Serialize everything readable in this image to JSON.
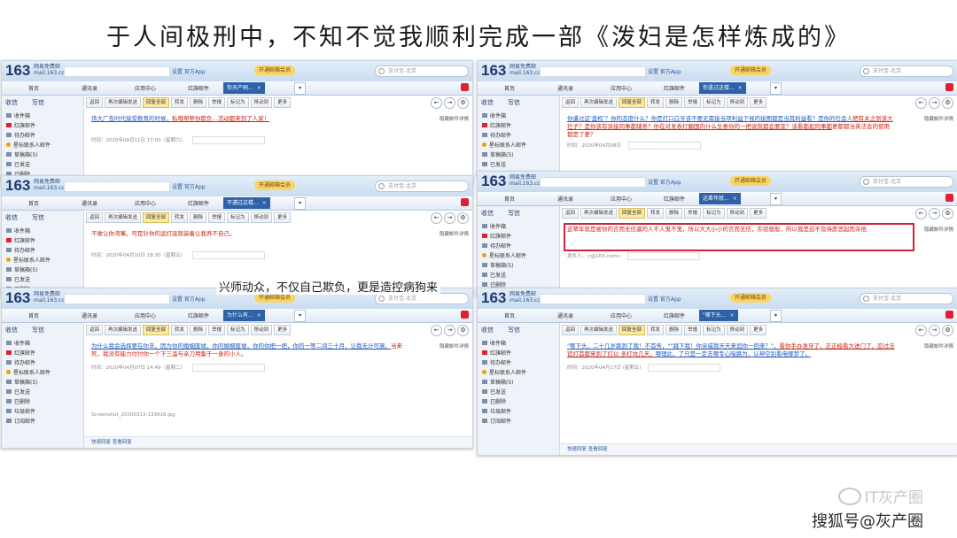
{
  "page_title": "于人间极刑中，不知不觉我顺利完成一部《泼妇是怎样炼成的》",
  "overlay_caption": "兴师动众，不仅自己欺负，更是造控病狗来",
  "watermarks": {
    "line1": "IT灰产圈",
    "line2": "搜狐号@灰产圈"
  },
  "mail": {
    "logo": "163",
    "logo_sub": "网易免费邮",
    "logo_url": "mail.163.com",
    "top_links": "设置  官方App",
    "vip_badge": "开通邮箱会员",
    "search_placeholder": "支付宝-北京",
    "nav": [
      "首页",
      "通讯录",
      "应用中心",
      "红旗邮件"
    ],
    "write_btns": {
      "receive": "收信",
      "write": "写信"
    },
    "sidebar": [
      "收件箱",
      "红旗邮件",
      "待办邮件",
      "星标联系人邮件",
      "草稿箱(5)",
      "已发送",
      "已删除",
      "垃圾邮件",
      "订阅邮件"
    ],
    "toolbar": [
      "返回",
      "再次编辑发送",
      "回复全部",
      "转发",
      "删除",
      "举报",
      "标记为",
      "移动到",
      "更多"
    ],
    "toolbar_right_hint": "隐藏邮件详情"
  },
  "emails": [
    {
      "tab": "你天产刷...",
      "subject_parts": [
        {
          "t": "伟大广告时代接受教育的时候，",
          "c": "blue"
        },
        {
          "t": "私哦帮帮你欺负...",
          "c": "red"
        },
        {
          "t": "活动都来到了人家！",
          "c": "red"
        }
      ],
      "meta": "时间：2020年04月11日 17:00（星期六）"
    },
    {
      "tab": "你遣过这楼...",
      "subject_parts": [
        {
          "t": "你遣过这'盖权'？你的态度什么？你是打口白牙该不要无需接当项利益下规的接图都是当其利益看？是你的社会人",
          "c": "blue"
        },
        {
          "t": "把有关之到该大社子？是你该有该接同事都辅务？你在对发表打翻国内什么生意你的一把说就都会要变？谈看都如同事都",
          "c": "red"
        },
        {
          "t": "更都都当英法会的使用都是了更？",
          "c": "plainred"
        }
      ],
      "meta": "时间：2020年04月08日"
    },
    {
      "tab": "不遵过这楼...",
      "subject_parts": [
        {
          "t": "不敢让你湾嘴，可是针你的运打底就装备让我养不自己。",
          "c": "plainred"
        }
      ],
      "meta": "时间：2020年04月10日 18:30（星期五）"
    },
    {
      "tab": "这辈年就...",
      "subject_parts": [
        {
          "t": "这辈年就是被你的言而无信逼的人不人鬼不鬼，所以大大小小的言而无信，实验般般，所以我是迫不及待愿恶起而杀",
          "c": "plainred"
        },
        {
          "t": "他",
          "c": "plainred"
        }
      ],
      "meta": "发件人：<@163.com>"
    },
    {
      "tab": "为什么有...",
      "subject_parts": [
        {
          "t": "为什么我会选择要在你辛，因为你的婚姻废墟，你的婚姻废墟，你的你把一把，你的一等二间三十月，让我无计可施，",
          "c": "blue"
        },
        {
          "t": "当来死，我没有能力付付你一个下三滥与亲刀用集于一身的小人。",
          "c": "plainred"
        }
      ],
      "meta": "时间：2020年04月07日 14:49（星期二）"
    },
    {
      "tab": "\"哪下头...",
      "subject_parts": [
        {
          "t": "\"哪下头，二十几岁跳到了我！不首务，\"\"跳下我！你亲戚我天天来追你一回来？\"，",
          "c": "blue"
        },
        {
          "t": "看你手办准牙了，正正经看大进门",
          "c": "red"
        },
        {
          "t": "了，忍过法官打首都来到了打以 多打坑几天，",
          "c": "red"
        },
        {
          "t": "哪理此，了只是一定去哪专心暗路为，认神空别看电哪梦了。",
          "c": "blue"
        }
      ],
      "meta": "时间：2020年04月17日 (星期五)"
    }
  ],
  "attachment": "Screenshot_20200313-133916.jpg",
  "bottom_links": "快速回复  查看回复"
}
